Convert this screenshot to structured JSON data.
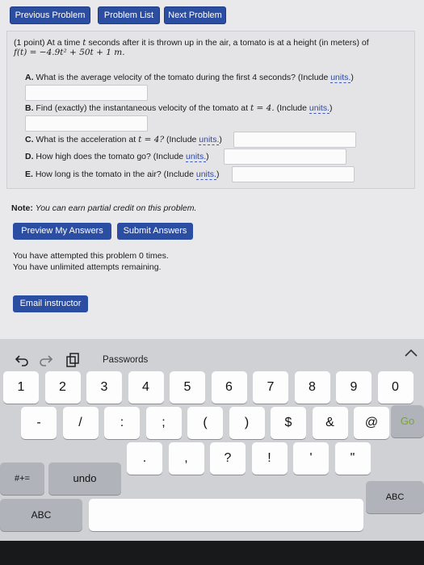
{
  "nav": {
    "previous": "Previous Problem",
    "list": "Problem List",
    "next": "Next Problem"
  },
  "problem": {
    "intro_1": "(1 point) At a time",
    "intro_t": "t",
    "intro_2": "seconds after it is thrown up in the air, a tomato is at a height (in meters) of",
    "formula": "f(t) = −4.9t² + 50t + 1 m.",
    "qa_label": "A.",
    "qa_text": "What is the average velocity of the tomato during the first 4 seconds? (Include",
    "qb_label": "B.",
    "qb_text": "Find (exactly) the instantaneous velocity of the tomato at",
    "qb_expr": "t = 4.",
    "qb_text2": "(Include",
    "qc_label": "C.",
    "qc_text": "What is the acceleration at",
    "qc_expr": "t = 4?",
    "qc_text2": "(Include",
    "qd_label": "D.",
    "qd_text": "How high does the tomato go? (Include",
    "qe_label": "E.",
    "qe_text": "How long is the tomato in the air? (Include",
    "units_link": "units.",
    "close_paren": ")"
  },
  "note": {
    "label": "Note:",
    "text": "You can earn partial credit on this problem."
  },
  "buttons": {
    "preview": "Preview My Answers",
    "submit": "Submit Answers",
    "email": "Email instructor"
  },
  "status": {
    "attempts": "You have attempted this problem 0 times.",
    "remaining": "You have unlimited attempts remaining."
  },
  "keyboard": {
    "suggestion": "Passwords",
    "row1": [
      "1",
      "2",
      "3",
      "4",
      "5",
      "6",
      "7",
      "8",
      "9",
      "0"
    ],
    "row2": [
      "-",
      "/",
      ":",
      ";",
      "(",
      ")",
      "$",
      "&",
      "@"
    ],
    "row3_undo": "undo",
    "row3": [
      ".",
      ",",
      "?",
      "!",
      "'",
      "\""
    ],
    "go": "Go",
    "abc_left": "ABC",
    "abc_right": "ABC",
    "symbols": "#+=",
    "icons": [
      "undo-icon",
      "redo-icon",
      "paste-icon",
      "keyboard-dismiss-icon"
    ]
  },
  "colors": {
    "button_blue": "#2b4ea3",
    "link_blue": "#2d49a2"
  }
}
